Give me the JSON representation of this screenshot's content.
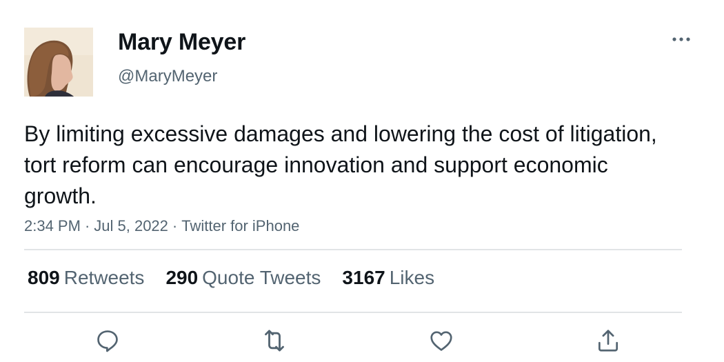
{
  "user": {
    "display_name": "Mary Meyer",
    "handle": "@MaryMeyer"
  },
  "tweet": {
    "text": "By limiting excessive damages and lowering the cost of litigation, tort reform can encourage innovation and support economic growth.",
    "time": "2:34 PM",
    "date": "Jul 5, 2022",
    "source": "Twitter for iPhone",
    "separator": "·"
  },
  "stats": {
    "retweets_count": "809",
    "retweets_label": "Retweets",
    "quotes_count": "290",
    "quotes_label": "Quote Tweets",
    "likes_count": "3167",
    "likes_label": "Likes"
  },
  "actions": [
    "reply-icon",
    "retweet-icon",
    "like-icon",
    "share-icon"
  ],
  "colors": {
    "text_primary": "#0f1419",
    "text_secondary": "#536471",
    "divider": "#e1e4e6"
  }
}
